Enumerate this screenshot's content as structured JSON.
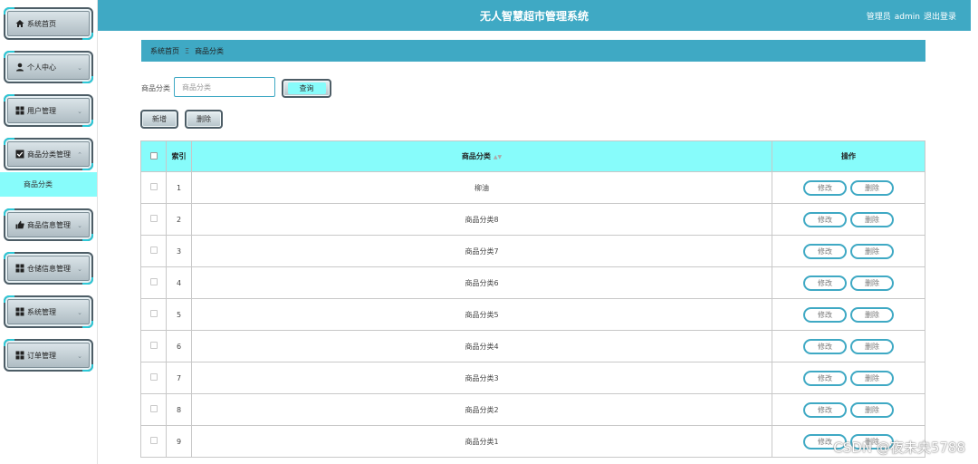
{
  "header": {
    "title": "无人智慧超市管理系统",
    "user_role": "管理员",
    "username": "admin",
    "logout_label": "退出登录"
  },
  "sidebar": {
    "items": [
      {
        "label": "系统首页",
        "icon": "home-icon"
      },
      {
        "label": "个人中心",
        "icon": "user-icon"
      },
      {
        "label": "用户管理",
        "icon": "grid-icon"
      },
      {
        "label": "商品分类管理",
        "icon": "checkbox-icon"
      },
      {
        "label": "商品信息管理",
        "icon": "thumbs-up-icon"
      },
      {
        "label": "仓储信息管理",
        "icon": "grid-icon"
      },
      {
        "label": "系统管理",
        "icon": "grid-icon"
      },
      {
        "label": "订单管理",
        "icon": "grid-icon"
      }
    ],
    "submenu": {
      "label": "商品分类"
    }
  },
  "breadcrumb": {
    "home": "系统首页",
    "separator": "Ξ",
    "current": "商品分类"
  },
  "search": {
    "label": "商品分类",
    "placeholder": "商品分类",
    "button_label": "查询"
  },
  "actions": {
    "add_label": "新增",
    "delete_label": "删除"
  },
  "table": {
    "headers": {
      "index": "索引",
      "category": "商品分类",
      "operation": "操作"
    },
    "rows": [
      {
        "index": "1",
        "category": "柳油"
      },
      {
        "index": "2",
        "category": "商品分类8"
      },
      {
        "index": "3",
        "category": "商品分类7"
      },
      {
        "index": "4",
        "category": "商品分类6"
      },
      {
        "index": "5",
        "category": "商品分类5"
      },
      {
        "index": "6",
        "category": "商品分类4"
      },
      {
        "index": "7",
        "category": "商品分类3"
      },
      {
        "index": "8",
        "category": "商品分类2"
      },
      {
        "index": "9",
        "category": "商品分类1"
      }
    ],
    "edit_label": "修改",
    "delete_label": "删除"
  },
  "watermark": "CSDN @夜未央5788",
  "colors": {
    "primary": "#3fa9c4",
    "accent": "#87fcfb"
  }
}
